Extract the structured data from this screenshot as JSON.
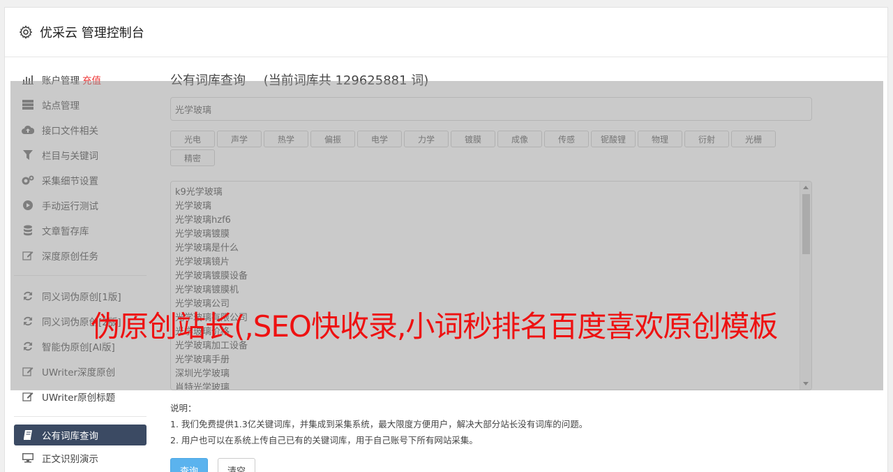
{
  "header": {
    "title": "优采云 管理控制台",
    "icon": "gear-icon"
  },
  "sidebar": {
    "items": [
      {
        "label": "账户管理",
        "extra": "充值",
        "icon": "bar-chart-icon"
      },
      {
        "label": "站点管理",
        "icon": "server-icon"
      },
      {
        "label": "接口文件相关",
        "icon": "cloud-upload-icon"
      },
      {
        "label": "栏目与关键词",
        "icon": "filter-icon"
      },
      {
        "label": "采集细节设置",
        "icon": "gears-icon"
      },
      {
        "label": "手动运行测试",
        "icon": "play-circle-icon"
      },
      {
        "label": "文章暂存库",
        "icon": "database-icon"
      },
      {
        "label": "深度原创任务",
        "icon": "edit-icon"
      }
    ],
    "items2": [
      {
        "label": "同义词伪原创[1版]",
        "icon": "refresh-icon"
      },
      {
        "label": "同义词伪原创[2版]",
        "icon": "refresh-icon"
      },
      {
        "label": "智能伪原创[AI版]",
        "icon": "refresh-icon"
      },
      {
        "label": "UWriter深度原创",
        "icon": "edit-icon"
      },
      {
        "label": "UWriter原创标题",
        "icon": "edit-icon"
      }
    ],
    "items3": [
      {
        "label": "公有词库查询",
        "icon": "book-icon",
        "active": true
      },
      {
        "label": "正文识别演示",
        "icon": "monitor-icon"
      }
    ]
  },
  "main": {
    "title": "公有词库查询",
    "count_text": "(当前词库共 129625881 词)",
    "keyword_value": "光学玻璃",
    "tags": [
      "光电",
      "声学",
      "热学",
      "偏振",
      "电学",
      "力学",
      "镀膜",
      "成像",
      "传感",
      "铌酸锂",
      "物理",
      "衍射",
      "光栅",
      "精密"
    ],
    "results": [
      "k9光学玻璃",
      "光学玻璃",
      "光学玻璃hzf6",
      "光学玻璃镀膜",
      "光学玻璃是什么",
      "光学玻璃镜片",
      "光学玻璃镀膜设备",
      "光学玻璃镀膜机",
      "光学玻璃公司",
      "光学玻璃有限公司",
      "光学玻璃价格",
      "光学玻璃加工设备",
      "光学玻璃手册",
      "深圳光学玻璃",
      "肖特光学玻璃"
    ],
    "notes_title": "说明：",
    "notes": [
      "1. 我们免费提供1.3亿关键词库，并集成到采集系统，最大限度方便用户，解决大部分站长没有词库的问题。",
      "2. 用户也可以在系统上传自己已有的关键词库，用于自己账号下所有网站采集。"
    ],
    "query_button": "查询",
    "clear_button": "清空"
  },
  "watermark": "伪原创站长(,SEO快收录,小词秒排名百度喜欢原创模板",
  "colors": {
    "active_bg": "#3b4a63",
    "primary": "#5bb3ee",
    "watermark": "#ee1111",
    "extra": "#e33333"
  }
}
